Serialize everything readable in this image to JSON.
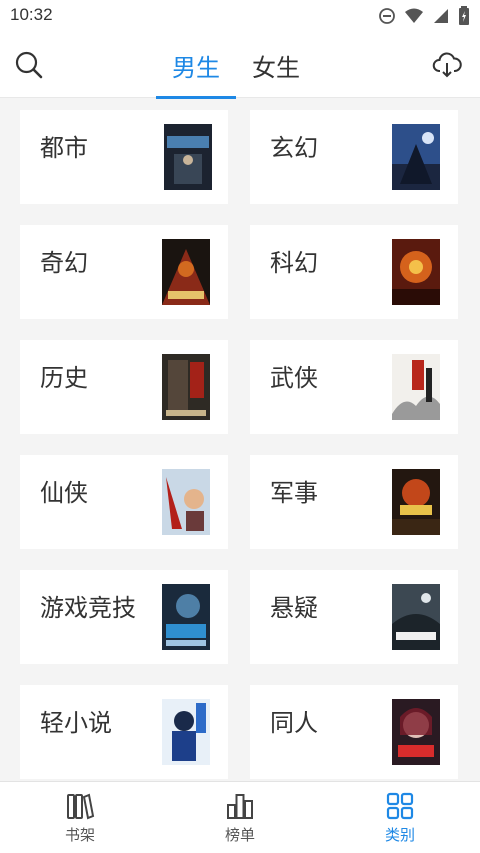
{
  "status_bar": {
    "time": "10:32",
    "icons": [
      "do-not-disturb-icon",
      "wifi-icon",
      "signal-icon",
      "battery-icon"
    ]
  },
  "header": {
    "tabs": [
      {
        "label": "男生",
        "active": true
      },
      {
        "label": "女生",
        "active": false
      }
    ],
    "search_icon": "search-icon",
    "download_icon": "cloud-download-icon"
  },
  "accent_color": "#1e88e5",
  "categories": [
    {
      "label": "都市"
    },
    {
      "label": "玄幻"
    },
    {
      "label": "奇幻"
    },
    {
      "label": "科幻"
    },
    {
      "label": "历史"
    },
    {
      "label": "武侠"
    },
    {
      "label": "仙侠"
    },
    {
      "label": "军事"
    },
    {
      "label": "游戏竞技"
    },
    {
      "label": "悬疑"
    },
    {
      "label": "轻小说"
    },
    {
      "label": "同人"
    }
  ],
  "bottom_nav": [
    {
      "label": "书架",
      "icon": "bookshelf-icon",
      "active": false
    },
    {
      "label": "榜单",
      "icon": "ranking-icon",
      "active": false
    },
    {
      "label": "类别",
      "icon": "category-grid-icon",
      "active": true
    }
  ]
}
